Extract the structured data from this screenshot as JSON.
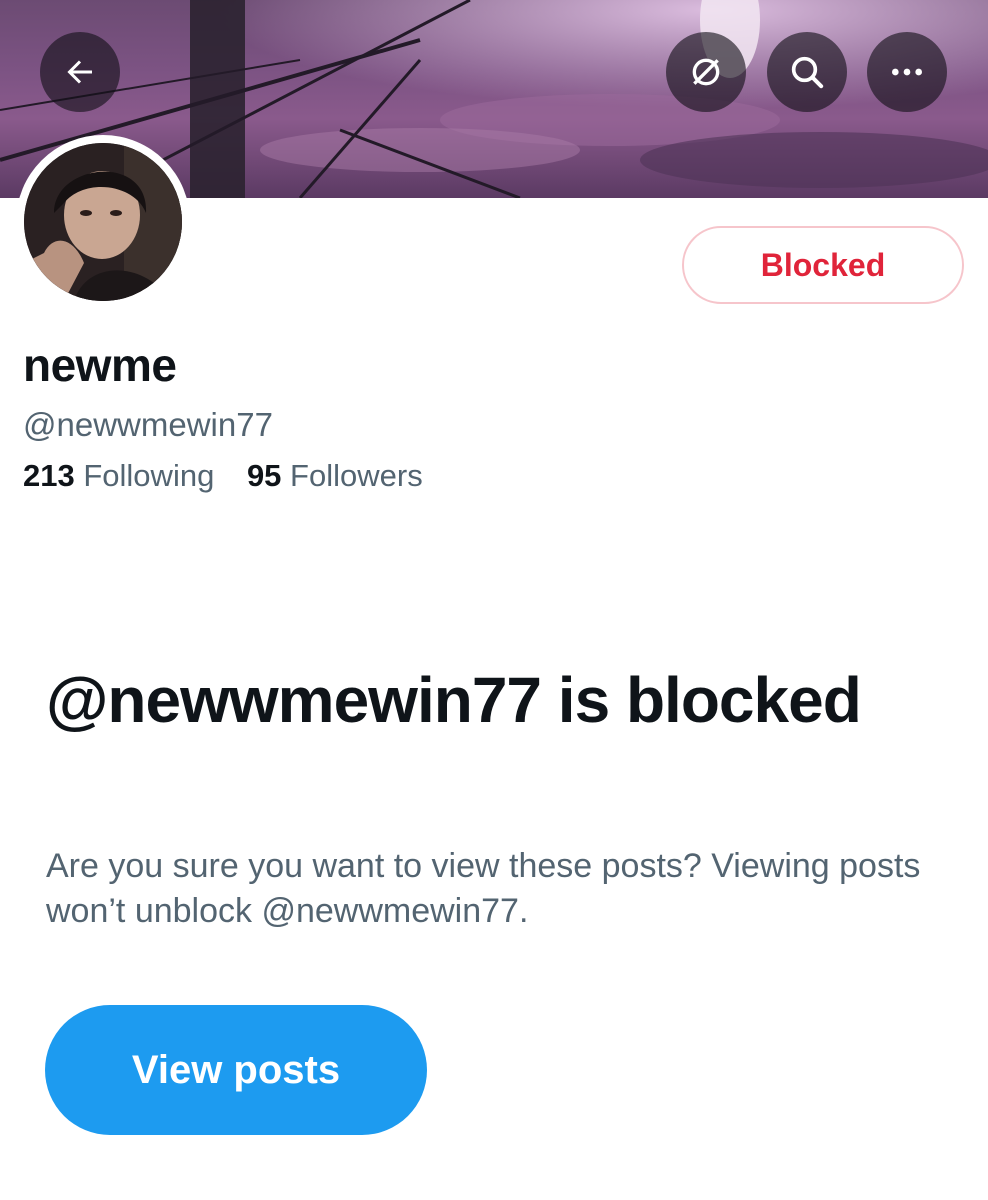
{
  "header": {
    "back_icon": "arrow-left-icon",
    "actions": [
      {
        "name": "unmute",
        "icon": "muted-slash-icon"
      },
      {
        "name": "search",
        "icon": "search-icon"
      },
      {
        "name": "more",
        "icon": "more-dots-icon"
      }
    ],
    "banner_colors": [
      "#6c4b73",
      "#8a5a8c",
      "#5b3a63"
    ]
  },
  "profile": {
    "display_name": "newme",
    "handle": "@newwmewin77",
    "following_count": "213",
    "following_label": "Following",
    "followers_count": "95",
    "followers_label": "Followers",
    "blocked_button_label": "Blocked"
  },
  "blocked_notice": {
    "title": "@newwmewin77 is blocked",
    "description": "Are you sure you want to view these posts? Viewing posts won’t unblock @newwmewin77.",
    "button_label": "View posts"
  },
  "colors": {
    "accent": "#1d9bf0",
    "danger": "#e0243a",
    "secondary_text": "#536471",
    "primary_text": "#0f1419"
  }
}
